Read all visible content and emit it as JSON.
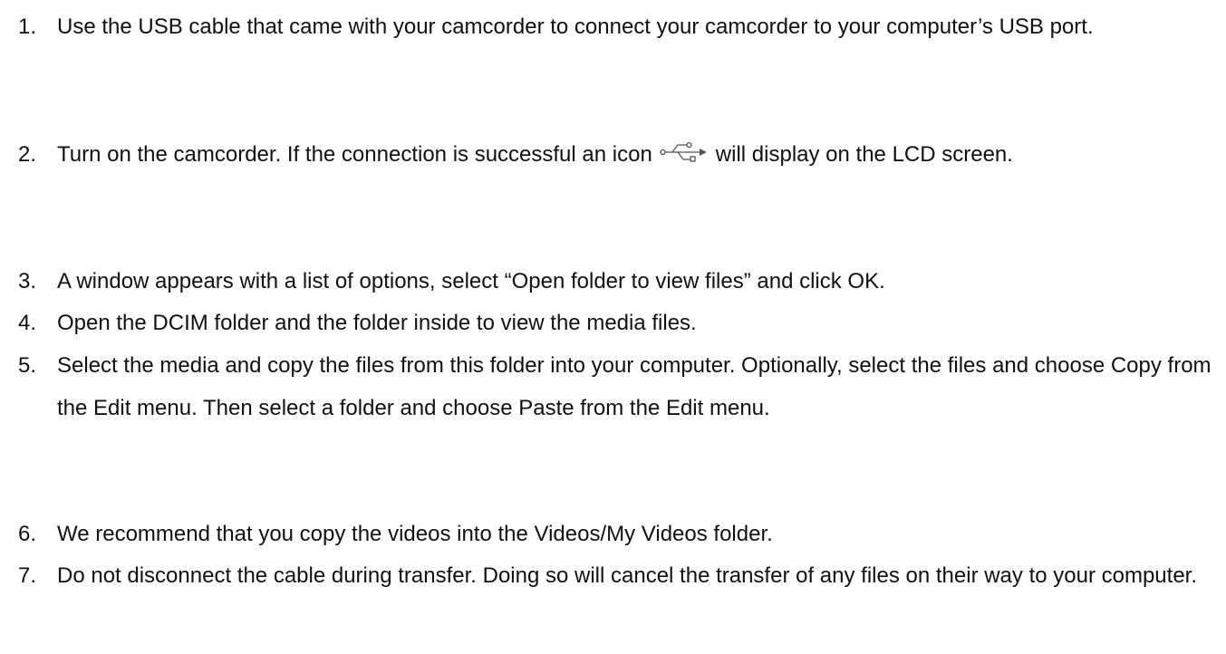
{
  "steps": [
    {
      "number": "1.",
      "text": "Use the USB cable that came with your camcorder to connect your camcorder to your computer’s USB port."
    },
    {
      "number": "2.",
      "text_before_icon": "Turn on the camcorder. If the connection is successful an icon",
      "icon": "usb-icon",
      "text_after_icon": "will display on the LCD screen."
    },
    {
      "number": "3.",
      "text": "A window appears with a list of options, select “Open folder to view files” and click OK."
    },
    {
      "number": "4.",
      "text": "Open the DCIM folder and the folder inside to view the media files."
    },
    {
      "number": "5.",
      "text": "Select the media and copy the files from this folder into your computer. Optionally, select the files and choose Copy from the Edit menu. Then select a folder and choose Paste from the Edit menu."
    },
    {
      "number": "6.",
      "text": "We recommend that you copy the videos into the Videos/My Videos folder."
    },
    {
      "number": "7.",
      "text": "Do not disconnect the cable during transfer. Doing so will cancel the transfer of any files on their way to your computer."
    }
  ]
}
